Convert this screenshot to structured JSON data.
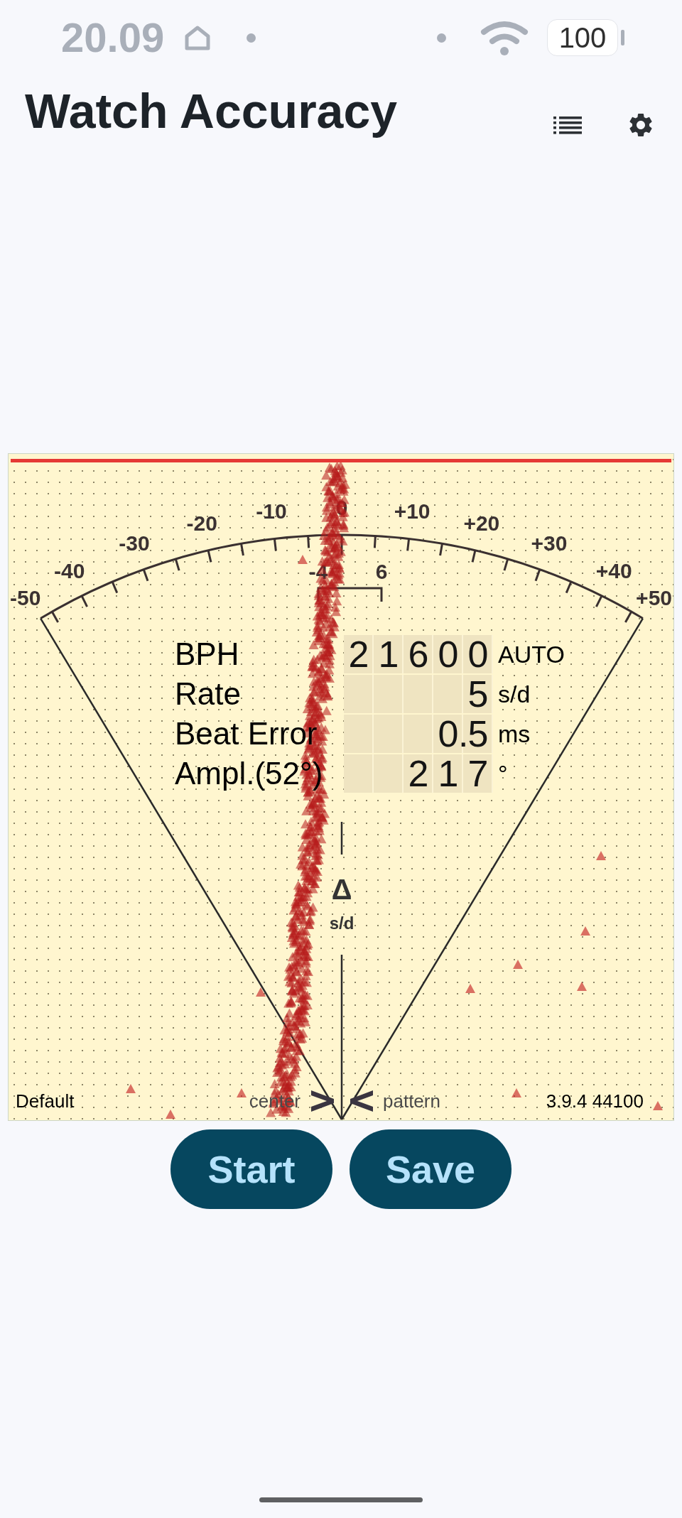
{
  "status_bar": {
    "time": "20.09",
    "battery": "100"
  },
  "app_bar": {
    "title": "Watch Accuracy"
  },
  "dial": {
    "scale_labels": [
      "-50",
      "-40",
      "-30",
      "-20",
      "-10",
      "0",
      "+10",
      "+20",
      "+30",
      "+40",
      "+50"
    ],
    "range_labels": [
      "-4",
      "6"
    ],
    "delta_symbol": "Δ",
    "delta_unit": "s/d"
  },
  "readings": [
    {
      "label": "BPH",
      "value": "21600",
      "unit": "AUTO"
    },
    {
      "label": "Rate",
      "value": "5",
      "unit": "s/d"
    },
    {
      "label": "Beat Error",
      "value": "0.5",
      "unit": "ms"
    },
    {
      "label": "Ampl.(52°)",
      "value": "217",
      "unit": "°"
    }
  ],
  "footer": {
    "left": "Default",
    "center_left": "center",
    "center_right": "pattern",
    "right": "3.9.4 44100"
  },
  "buttons": [
    {
      "label": "Start"
    },
    {
      "label": "Save"
    }
  ]
}
